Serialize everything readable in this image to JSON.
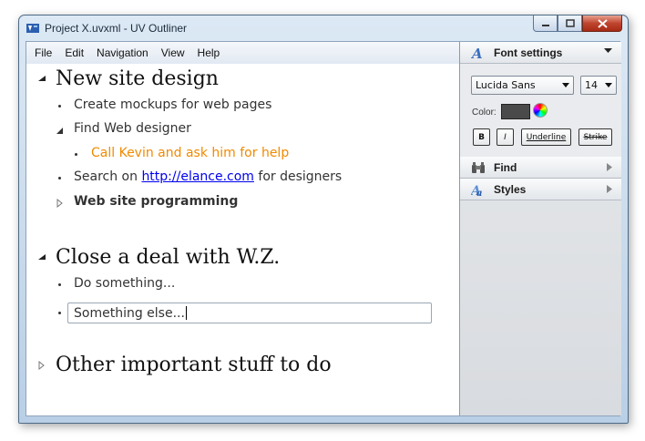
{
  "window": {
    "title": "Project X.uvxml - UV Outliner"
  },
  "menu": [
    "File",
    "Edit",
    "Navigation",
    "View",
    "Help"
  ],
  "outline": {
    "h1": "New site design",
    "i1": "Create mockups for web pages",
    "i2": "Find Web designer",
    "i3": "Call Kevin and ask him for help",
    "i4_pre": "Search on ",
    "i4_link": "http://elance.com",
    "i4_post": " for designers",
    "i5": "Web site programming",
    "h2": "Close a deal with W.Z.",
    "i6": "Do something...",
    "i7_edit": "Something else...",
    "h3": "Other important stuff to do"
  },
  "panel": {
    "font_settings": "Font settings",
    "font_name": "Lucida Sans",
    "font_size": "14",
    "color_label": "Color:",
    "current_color": "#4a4a4a",
    "bold": "B",
    "italic": "I",
    "underline": "Underline",
    "strike": "Strike",
    "find": "Find",
    "styles": "Styles"
  },
  "colors": {
    "orange_item": "#f08a00",
    "link": "#0000ee"
  }
}
